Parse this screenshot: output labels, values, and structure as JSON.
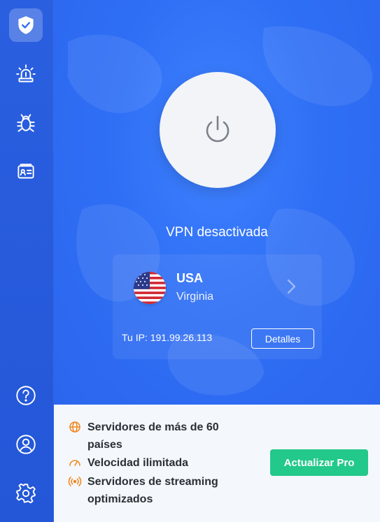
{
  "sidebar": {
    "top_items": [
      {
        "name": "shield-icon",
        "active": true
      },
      {
        "name": "alarm-icon",
        "active": false
      },
      {
        "name": "bug-icon",
        "active": false
      },
      {
        "name": "id-card-icon",
        "active": false
      }
    ],
    "bottom_items": [
      {
        "name": "help-icon"
      },
      {
        "name": "account-icon"
      },
      {
        "name": "settings-icon"
      }
    ]
  },
  "main": {
    "status": "VPN desactivada",
    "location": {
      "country": "USA",
      "region": "Virginia",
      "flag": "us-flag-icon"
    },
    "ip_text": "Tu IP: 191.99.26.113",
    "details_label": "Detalles"
  },
  "promo": {
    "features": [
      {
        "icon": "globe-icon",
        "text": "Servidores de más de 60 países"
      },
      {
        "icon": "speedometer-icon",
        "text": "Velocidad ilimitada"
      },
      {
        "icon": "broadcast-icon",
        "text": "Servidores de streaming optimizados"
      }
    ],
    "upgrade_label": "Actualizar Pro"
  },
  "colors": {
    "accent_blue": "#2f6cf0",
    "upgrade_green": "#23c98a",
    "feature_orange": "#f08a24"
  }
}
